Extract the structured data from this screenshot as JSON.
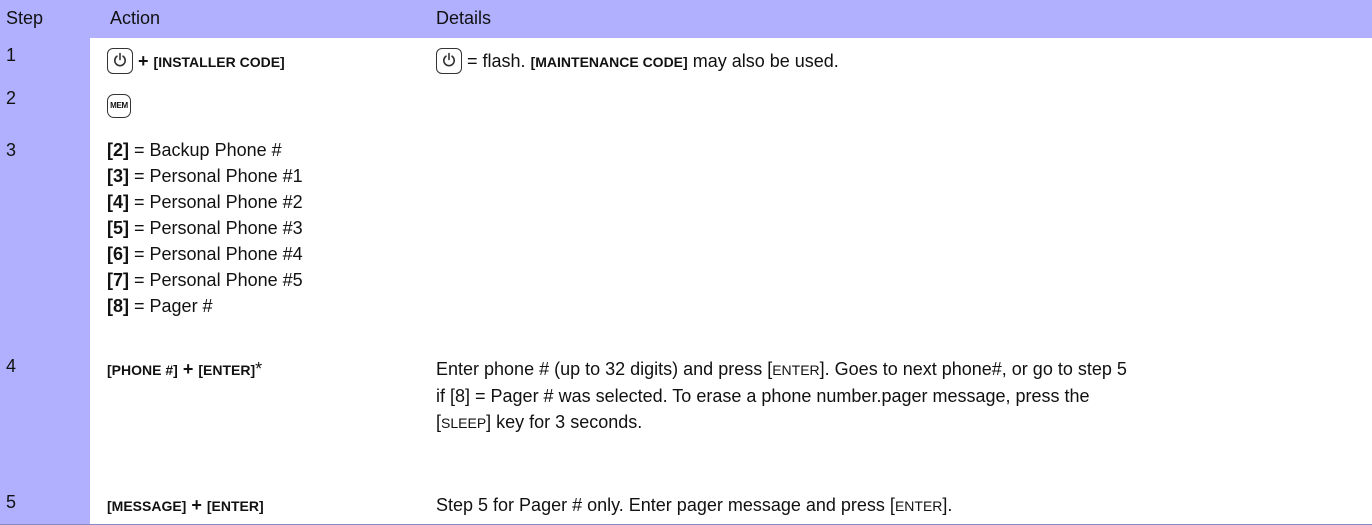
{
  "header": {
    "step": "Step",
    "action": "Action",
    "details": "Details"
  },
  "rows": [
    {
      "step": "1",
      "action": {
        "plus": "+",
        "code": "[INSTALLER CODE]"
      },
      "details": {
        "eq": "= flash.",
        "code": "[MAINTENANCE CODE]",
        "rest": "may also be used."
      }
    },
    {
      "step": "2",
      "action": {
        "key_label": "MEM"
      }
    },
    {
      "step": "3",
      "action": {
        "lines": [
          {
            "key": "[2]",
            "text": "= Backup Phone #"
          },
          {
            "key": "[3]",
            "text": "= Personal Phone #1"
          },
          {
            "key": "[4]",
            "text": "= Personal Phone #2"
          },
          {
            "key": "[5]",
            "text": "= Personal Phone #3"
          },
          {
            "key": "[6]",
            "text": "= Personal Phone #4"
          },
          {
            "key": "[7]",
            "text": "= Personal Phone #5"
          },
          {
            "key": "[8]",
            "text": "= Pager #"
          }
        ]
      }
    },
    {
      "step": "4",
      "action": {
        "code1": "[PHONE #]",
        "plus": "+",
        "code2": "[ENTER]",
        "star": "*"
      },
      "details": {
        "l1a": "Enter phone # (up to 32 digits) and press [",
        "l1b": "ENTER",
        "l1c": "]. Goes to next phone#, or go to step 5",
        "l2": "if [8] = Pager # was selected. To erase a phone number.pager message, press the",
        "l3a": "[",
        "l3b": "SLEEP",
        "l3c": "] key for 3 seconds."
      }
    },
    {
      "step": "5",
      "action": {
        "code1": "[MESSAGE]",
        "plus": "+",
        "code2": "[ENTER]"
      },
      "details": {
        "a": "Step 5 for Pager # only. Enter pager message and press [",
        "b": "ENTER",
        "c": "]."
      }
    }
  ],
  "icons": {
    "power": "power-icon",
    "mem": "mem-key-icon"
  },
  "colors": {
    "header_bg": "#b0b0ff",
    "step_bg": "#b0b0ff"
  }
}
